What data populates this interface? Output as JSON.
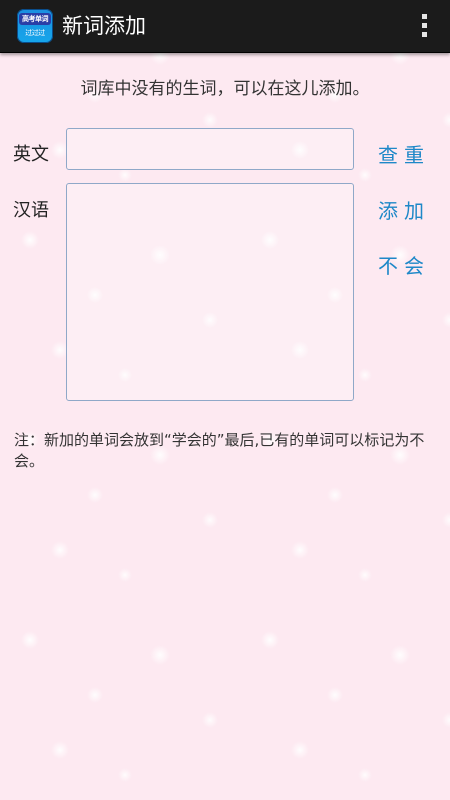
{
  "app": {
    "title": "新词添加",
    "icon_top_text": "高考单词",
    "icon_bottom_text": "过过过",
    "menu_icon": "overflow-menu-icon"
  },
  "form": {
    "hint": "词库中没有的生词，可以在这儿添加。",
    "english_label": "英文",
    "chinese_label": "汉语",
    "english_value": "",
    "chinese_value": ""
  },
  "actions": {
    "check_duplicate": "查重",
    "add": "添加",
    "unknown": "不会"
  },
  "note": "注：新加的单词会放到“学会的”最后,已有的单词可以标记为不会。",
  "colors": {
    "action_bar": "#1b1b1b",
    "background": "#fde9f1",
    "link": "#1e88c8",
    "input_border": "#8fa8c8"
  }
}
